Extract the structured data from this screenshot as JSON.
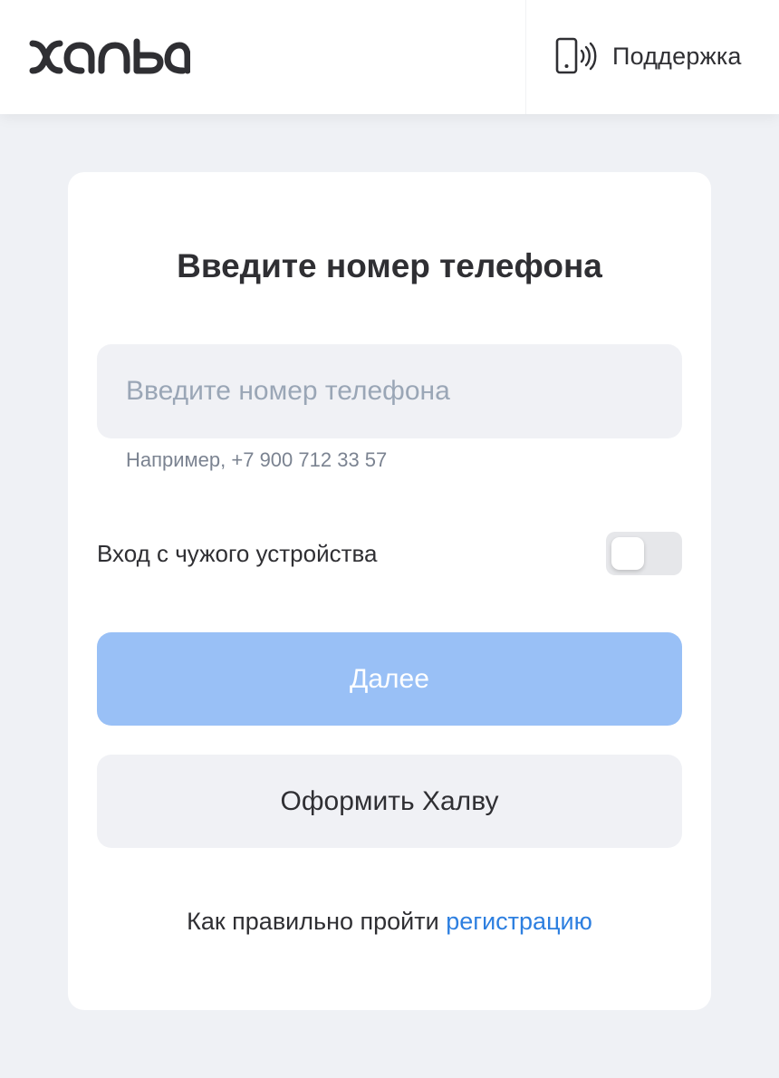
{
  "header": {
    "logo_text": "ХАЛВА",
    "support_icon": "phone-signal-icon",
    "support_label": "Поддержка"
  },
  "form": {
    "title": "Введите номер телефона",
    "phone_placeholder": "Введите номер телефона",
    "phone_value": "",
    "hint": "Например, +7 900 712 33 57",
    "foreign_device_label": "Вход с чужого устройства",
    "foreign_device_enabled": false,
    "next_label": "Далее",
    "apply_label": "Оформить Халву",
    "help_text": "Как правильно пройти",
    "help_link": "регистрацию"
  },
  "colors": {
    "background": "#eff1f5",
    "primary_disabled": "#99c0f6",
    "link": "#2d7fe0",
    "input_bg": "#f0f1f5"
  }
}
